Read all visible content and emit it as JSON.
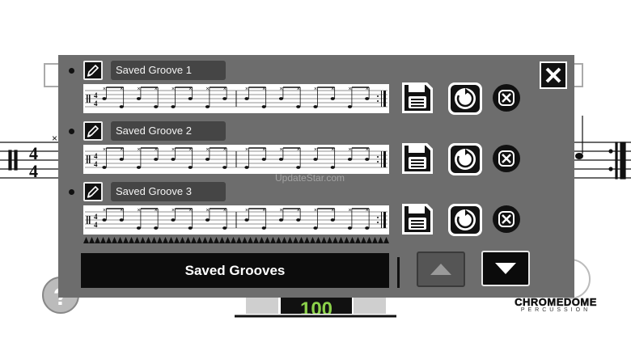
{
  "modal": {
    "slots": [
      {
        "name": "Saved Groove 1"
      },
      {
        "name": "Saved Groove 2"
      },
      {
        "name": "Saved Groove 3"
      }
    ],
    "footer_label": "Saved Grooves"
  },
  "background": {
    "tempo_value": "100",
    "brand_name": "CHROMEDOME",
    "brand_sub": "PERCUSSION",
    "watermark": "UpdateStar.com"
  },
  "icons": {
    "edit": "pencil-icon",
    "save": "floppy-disk-icon",
    "load": "circular-arrow-icon",
    "delete": "x-circle-icon",
    "close": "close-icon",
    "up": "triangle-up-icon",
    "down": "triangle-down-icon",
    "help": "question-mark-icon"
  },
  "colors": {
    "modal_bg": "#6d6d6d",
    "name_field_bg": "#454545",
    "tempo_text": "#8bd14a"
  }
}
